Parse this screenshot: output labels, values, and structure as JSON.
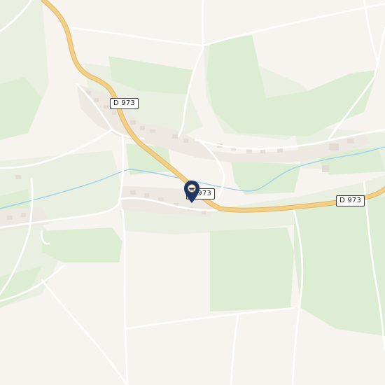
{
  "map": {
    "road_shields": [
      {
        "id": "shield-1",
        "label": "D 973"
      },
      {
        "id": "shield-2",
        "label": "D 973"
      },
      {
        "id": "shield-3",
        "label": "D 973"
      }
    ],
    "marker": {
      "icon": "location-pin-icon",
      "color": "#1f3566"
    },
    "colors": {
      "land": "#f7f3ee",
      "forest": "#dcedd3",
      "meadow": "#e9f0e1",
      "main_road": "#f2cf86",
      "minor_road": "#ffffff",
      "water": "#9fd0ea"
    }
  }
}
